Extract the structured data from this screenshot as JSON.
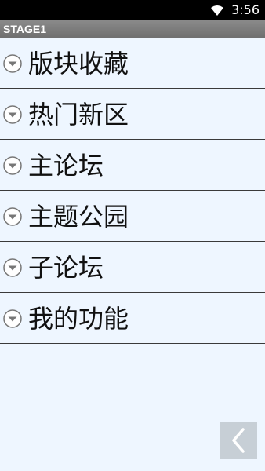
{
  "status_bar": {
    "time": "3:56",
    "wifi_icon": "wifi-icon"
  },
  "app_bar": {
    "title": "STAGE1"
  },
  "menu": {
    "items": [
      {
        "label": "版块收藏",
        "icon": "expand-circle-icon"
      },
      {
        "label": "热门新区",
        "icon": "expand-circle-icon"
      },
      {
        "label": "主论坛",
        "icon": "expand-circle-icon"
      },
      {
        "label": "主题公园",
        "icon": "expand-circle-icon"
      },
      {
        "label": "子论坛",
        "icon": "expand-circle-icon"
      },
      {
        "label": "我的功能",
        "icon": "expand-circle-icon"
      }
    ]
  },
  "back_button": {
    "icon": "chevron-left-icon"
  },
  "colors": {
    "status_bar": "#000000",
    "app_bar": "#7d7d7d",
    "background": "#eef6ff",
    "back_button": "#c7cfd6"
  }
}
